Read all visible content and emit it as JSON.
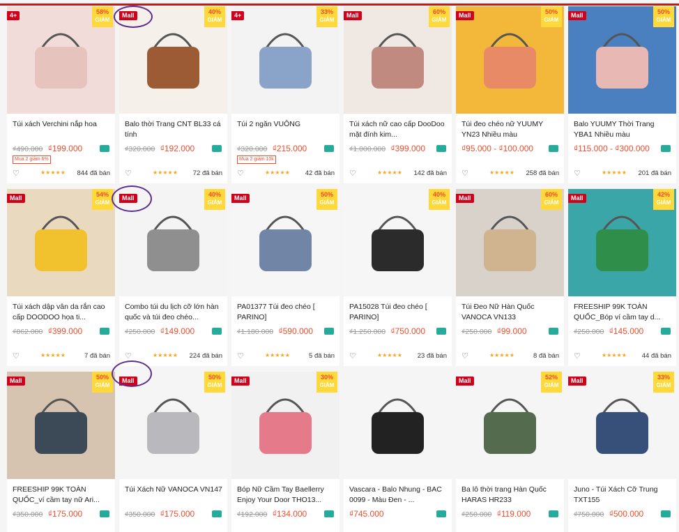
{
  "products": [
    {
      "title": "Túi xách Verchini nắp hoa",
      "old": "₫490.000",
      "price": "₫199.000",
      "disc": "58%",
      "disc_word": "GIẢM",
      "mall": "4+",
      "promo": "Mua 2 giảm 6%",
      "sold": "844 đã bán",
      "img": "#f1dcd9",
      "obj": "#e7c3bd"
    },
    {
      "title": "Balo thời Trang CNT BL33 cá tính",
      "old": "₫320.000",
      "price": "₫192.000",
      "disc": "40%",
      "disc_word": "GIẢM",
      "mall": "Mall",
      "promo": "",
      "sold": "72 đã bán",
      "img": "#f5f0ea",
      "obj": "#9c5a35"
    },
    {
      "title": "Túi 2 ngăn VUÔNG",
      "old": "₫320.000",
      "price": "₫215.000",
      "disc": "33%",
      "disc_word": "GIẢM",
      "mall": "4+",
      "promo": "Mua 2 giảm 10k",
      "sold": "42 đã bán",
      "img": "#f3f3f3",
      "obj": "#8aa3c8"
    },
    {
      "title": "Túi xách nữ cao cấp DooDoo mặt đính kim...",
      "old": "₫1.000.000",
      "price": "₫399.000",
      "disc": "60%",
      "disc_word": "GIẢM",
      "mall": "Mall",
      "promo": "",
      "sold": "142 đã bán",
      "img": "#efe8e3",
      "obj": "#c08a80"
    },
    {
      "title": "Túi đeo chéo nữ YUUMY YN23 Nhiều màu",
      "old": "",
      "price": "₫95.000 - ₫100.000",
      "disc": "50%",
      "disc_word": "GIẢM",
      "mall": "Mall",
      "promo": "",
      "sold": "258 đã bán",
      "img": "#f3b83a",
      "obj": "#e98a67"
    },
    {
      "title": "Balo YUUMY Thời Trang YBA1 Nhiều màu",
      "old": "",
      "price": "₫115.000 - ₫300.000",
      "disc": "50%",
      "disc_word": "GIẢM",
      "mall": "Mall",
      "promo": "",
      "sold": "201 đã bán",
      "img": "#4a7fc0",
      "obj": "#e8b8b4"
    },
    {
      "title": "Túi xách dập vân da rắn cao cấp DOODOO họa ti...",
      "old": "₫862.000",
      "price": "₫399.000",
      "disc": "54%",
      "disc_word": "GIẢM",
      "mall": "Mall",
      "promo": "",
      "sold": "7 đã bán",
      "img": "#e9d9bf",
      "obj": "#f2c12e"
    },
    {
      "title": "Combo túi du lịch cỡ lớn hàn quốc và túi đeo chéo...",
      "old": "₫250.000",
      "price": "₫149.000",
      "disc": "40%",
      "disc_word": "GIẢM",
      "mall": "Mall",
      "promo": "",
      "sold": "224 đã bán",
      "img": "#f4f4f4",
      "obj": "#8f8f8f"
    },
    {
      "title": "PA01377 Túi đeo chéo [ PARINO]",
      "old": "₫1.180.000",
      "price": "₫590.000",
      "disc": "50%",
      "disc_word": "GIẢM",
      "mall": "Mall",
      "promo": "",
      "sold": "5 đã bán",
      "img": "#f6f6f6",
      "obj": "#7185a6"
    },
    {
      "title": "PA15028 Túi đeo chéo [ PARINO]",
      "old": "₫1.250.000",
      "price": "₫750.000",
      "disc": "40%",
      "disc_word": "GIẢM",
      "mall": "",
      "promo": "",
      "sold": "23 đã bán",
      "img": "#f6f6f6",
      "obj": "#2b2b2b"
    },
    {
      "title": "Túi Đeo Nữ Hàn Quốc VANOCA VN133",
      "old": "₫250.000",
      "price": "₫99.000",
      "disc": "60%",
      "disc_word": "GIẢM",
      "mall": "Mall",
      "promo": "",
      "sold": "8 đã bán",
      "img": "#d8d2cb",
      "obj": "#cfb48f"
    },
    {
      "title": "FREESHIP 99K TOÀN QUỐC_Bóp ví cầm tay d...",
      "old": "₫250.000",
      "price": "₫145.000",
      "disc": "42%",
      "disc_word": "GIẢM",
      "mall": "Mall",
      "promo": "",
      "sold": "44 đã bán",
      "img": "#3aa6a8",
      "obj": "#2f8f4a"
    },
    {
      "title": "FREESHIP 99K TOÀN QUỐC_ví cầm tay nữ Ari...",
      "old": "₫350.000",
      "price": "₫175.000",
      "disc": "50%",
      "disc_word": "GIẢM",
      "mall": "Mall",
      "promo": "",
      "sold": "",
      "img": "#d7c4b0",
      "obj": "#3c4a57"
    },
    {
      "title": "Túi Xách Nữ VANOCA VN147",
      "old": "₫350.000",
      "price": "₫175.000",
      "disc": "50%",
      "disc_word": "GIẢM",
      "mall": "Mall",
      "promo": "",
      "sold": "",
      "img": "#f5f5f5",
      "obj": "#b9b9bd"
    },
    {
      "title": "Bóp Nữ Cầm Tay Baellerry Enjoy Your Door THO13...",
      "old": "₫192.000",
      "price": "₫134.000",
      "disc": "30%",
      "disc_word": "GIẢM",
      "mall": "Mall",
      "promo": "",
      "sold": "",
      "img": "#f1f1f1",
      "obj": "#e57b8a"
    },
    {
      "title": "Vascara - Balo Nhung - BAC 0099 - Màu Đen - ...",
      "old": "",
      "price": "₫745.000",
      "disc": "",
      "disc_word": "",
      "mall": "",
      "promo": "",
      "sold": "",
      "img": "#f5f5f5",
      "obj": "#222222"
    },
    {
      "title": "Ba lô thời trang Hàn Quốc HARAS HR233",
      "old": "₫250.000",
      "price": "₫119.000",
      "disc": "52%",
      "disc_word": "GIẢM",
      "mall": "Mall",
      "promo": "",
      "sold": "",
      "img": "#f5f5f5",
      "obj": "#556b4d"
    },
    {
      "title": "Juno - Túi Xách Cỡ Trung TXT155",
      "old": "₫750.000",
      "price": "₫500.000",
      "disc": "33%",
      "disc_word": "GIẢM",
      "mall": "Mall",
      "promo": "",
      "sold": "",
      "img": "#f5f5f5",
      "obj": "#37507a"
    }
  ],
  "icons": {
    "heart": "♡",
    "stars": "★★★★★"
  }
}
